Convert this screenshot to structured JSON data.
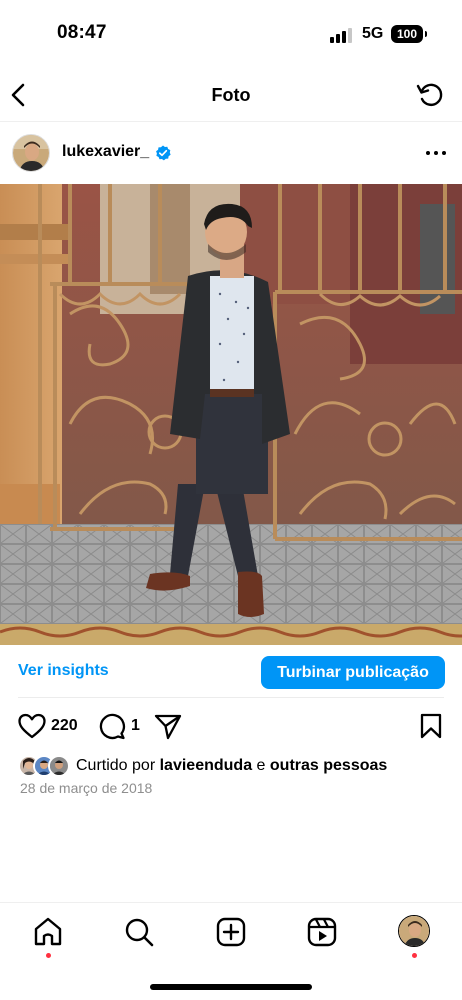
{
  "status_bar": {
    "time": "08:47",
    "network": "5G",
    "battery": "100"
  },
  "header": {
    "title": "Foto",
    "back_icon": "chevron-left-icon",
    "refresh_icon": "refresh-icon"
  },
  "post": {
    "username": "lukexavier_",
    "verified": true,
    "more_icon": "more-dots-icon",
    "photo_alt": "Foto do post",
    "insights_label": "Ver insights",
    "boost_label": "Turbinar publicação",
    "likes_count": "220",
    "comments_count": "1",
    "liked_prefix": "Curtido por",
    "liked_user": "lavieenduda",
    "liked_conjunction": "e",
    "liked_others": "outras pessoas",
    "date": "28 de março de 2018"
  },
  "tab_bar": {
    "items": [
      "home-icon",
      "search-icon",
      "create-icon",
      "reels-icon",
      "profile-avatar"
    ]
  },
  "colors": {
    "accent": "#0095f6",
    "notification": "#ff3040"
  }
}
